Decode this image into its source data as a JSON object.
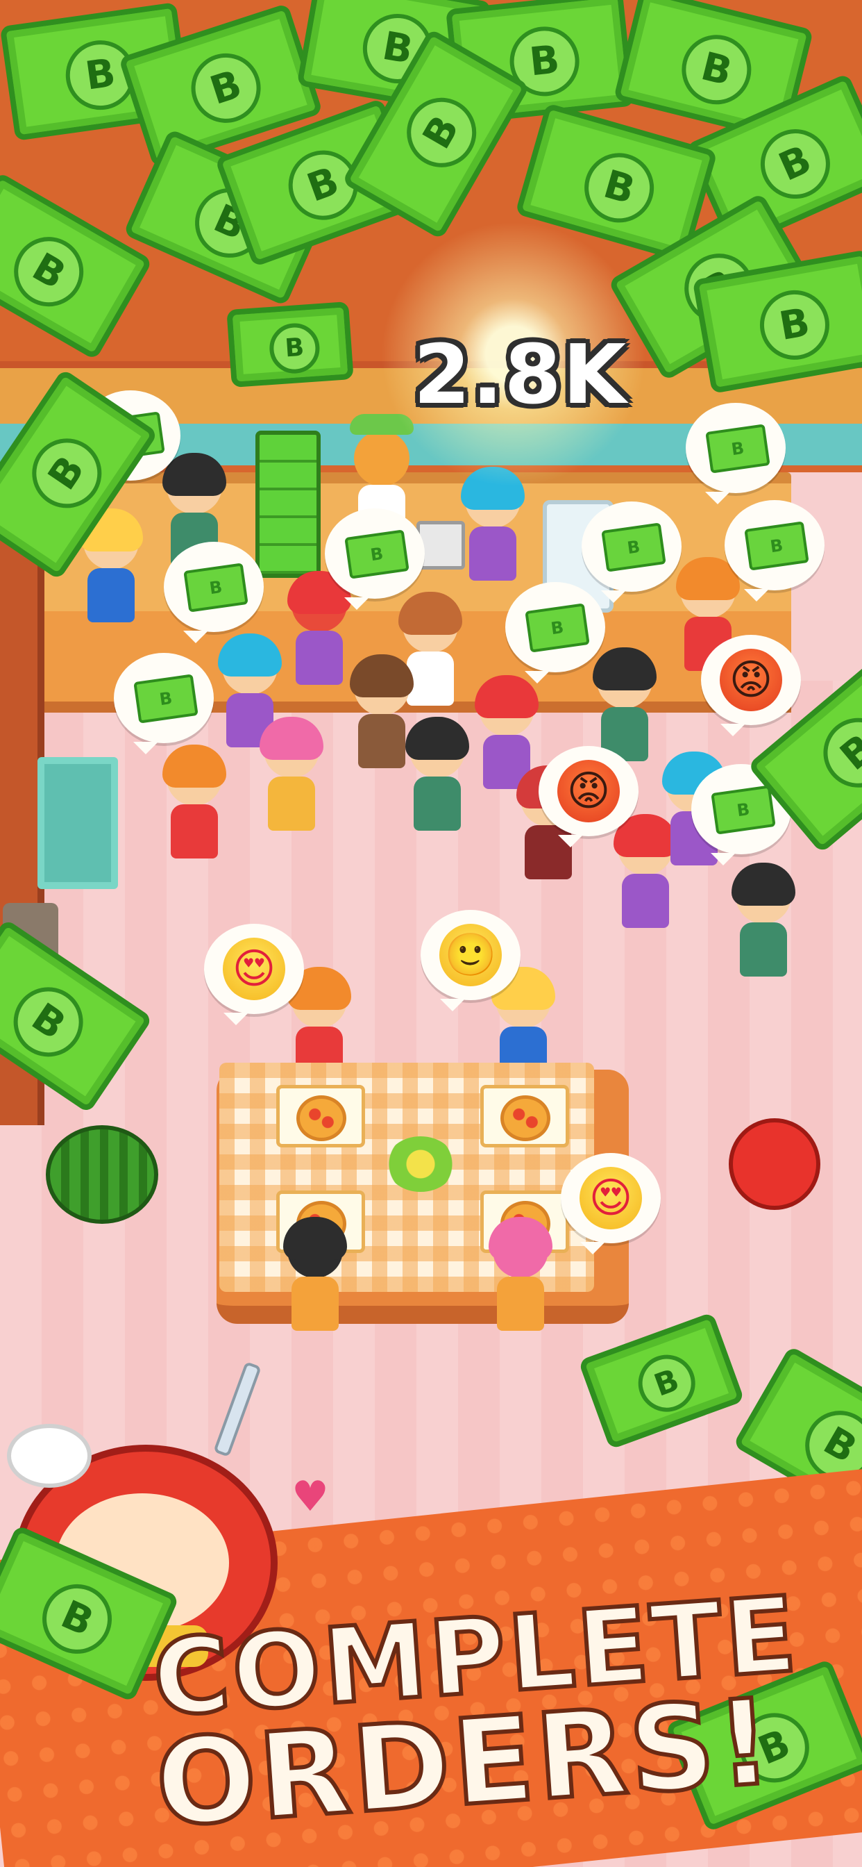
{
  "hud": {
    "earnings_amount": "2.8K"
  },
  "banner": {
    "line1": "COMPLETE",
    "line2": "ORDERS!"
  },
  "bill_mark": "B",
  "icons": {
    "bill": "cash-bill-icon",
    "angry": "angry-face-icon",
    "love": "heart-eyes-face-icon",
    "smile": "smiling-face-icon"
  },
  "emoji": {
    "angry": "😡",
    "love": "😍",
    "smile": "🙂"
  },
  "colors": {
    "money_green": "#6bd637",
    "banner_orange": "#ef6a2e",
    "floor_pink": "#f6c6c6"
  }
}
